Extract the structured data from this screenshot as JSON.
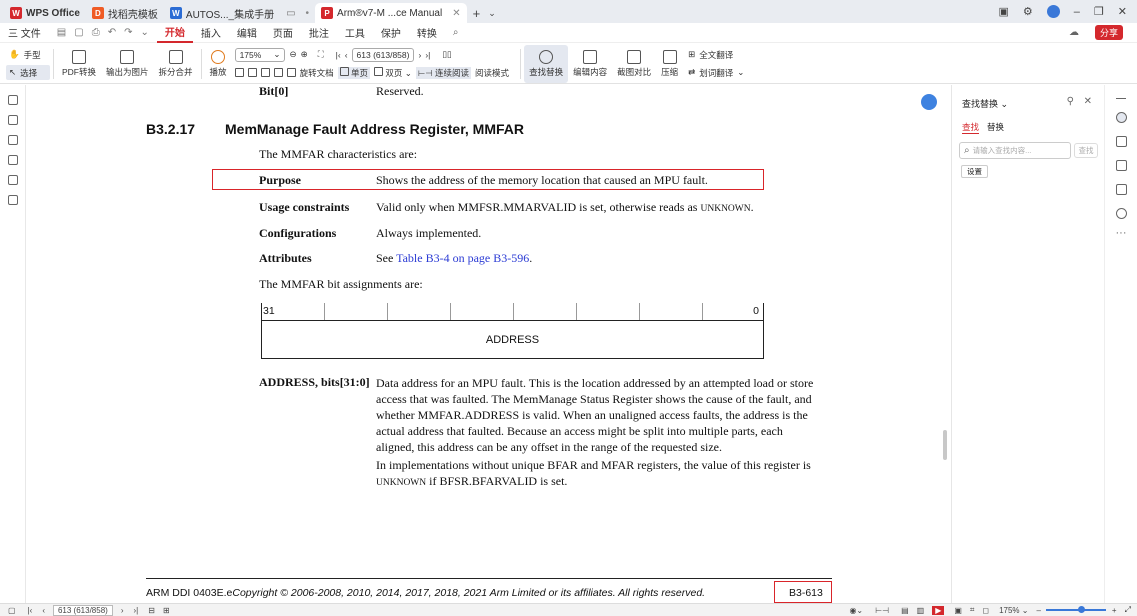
{
  "tabs": [
    {
      "label": "WPS Office",
      "icon": "wps-logo-icon",
      "color": "#d4282d",
      "active": false
    },
    {
      "label": "找稻壳模板",
      "icon": "docer-icon",
      "color": "#ef5b25",
      "active": false
    },
    {
      "label": "AUTOS..._集成手册",
      "icon": "word-doc-icon",
      "color": "#2b6cd4",
      "active": false
    },
    {
      "label": "Arm®v7-M ...ce Manual",
      "icon": "pdf-icon",
      "color": "#d4282d",
      "active": true
    }
  ],
  "menu": {
    "file": "三 文件",
    "items": [
      "开始",
      "插入",
      "编辑",
      "页面",
      "批注",
      "工具",
      "保护",
      "转换"
    ],
    "active": "开始",
    "share": "分享"
  },
  "ribbon": {
    "hand": "手型",
    "select": "选择",
    "pdf_convert": "PDF转换",
    "export_img": "输出为图片",
    "split_merge": "拆分合并",
    "play": "播放",
    "zoom": "175%",
    "page_input": "613 (613/858)",
    "rotate": "旋转文档",
    "single": "单页",
    "double": "双页",
    "continuous": "连续阅读",
    "reading_mode": "阅读模式",
    "find_replace": "查找替换",
    "edit_content": "编辑内容",
    "screenshot_compare": "截图对比",
    "compress": "压缩",
    "full_translate": "全文翻译",
    "word_translate": "划词翻译"
  },
  "doc": {
    "prev_row_field": "Bit[0]",
    "prev_row_desc": "Reserved.",
    "section_no": "B3.2.17",
    "section_title": "MemManage Fault Address Register, MMFAR",
    "intro": "The MMFAR characteristics are:",
    "rows": [
      {
        "k": "Purpose",
        "v": "Shows the address of the memory location that caused an MPU fault."
      },
      {
        "k": "Usage constraints",
        "v": "Valid only when MMFSR.MMARVALID is set, otherwise reads as",
        "v2": "UNKNOWN",
        "v3": "."
      },
      {
        "k": "Configurations",
        "v": "Always implemented."
      },
      {
        "k": "Attributes",
        "v": "See ",
        "link": "Table B3-4 on page B3-596",
        "v3": "."
      }
    ],
    "bit_intro": "The MMFAR bit assignments are:",
    "bit_hi": "31",
    "bit_lo": "0",
    "field": "ADDRESS",
    "field_desc_label": "ADDRESS, bits[31:0]",
    "field_desc_lines": [
      "Data address for an MPU fault. This is the location addressed by an attempted load or store",
      "access that was faulted. The MemManage Status Register shows the cause of the fault, and",
      "whether MMFAR.ADDRESS is valid. When an unaligned access faults, the address is the",
      "actual address that faulted. Because an access might be split into multiple parts, each",
      "aligned, this address can be any offset in the range of the requested size."
    ],
    "para2_l1": "In implementations without unique BFAR and MFAR registers, the value of this register is",
    "para2_l2a": "UNKNOWN",
    "para2_l2b": " if BFSR.BFARVALID is set.",
    "footer": "ARM DDI 0403E.e",
    "footer_copy": "Copyright © 2006-2008, 2010, 2014, 2017, 2018, 2021 Arm Limited or its affiliates. All rights reserved.",
    "page_label": "B3-613"
  },
  "panel": {
    "title": "查找替换",
    "tab_find": "查找",
    "tab_replace": "替换",
    "placeholder": "请输入查找内容...",
    "find_btn": "查找",
    "settings": "设置"
  },
  "status": {
    "page": "613 (613/858)",
    "zoom": "175%"
  },
  "colors": {
    "accent": "#d4282d",
    "link": "#2b3bd4",
    "highlight_box": "#d9252a"
  }
}
